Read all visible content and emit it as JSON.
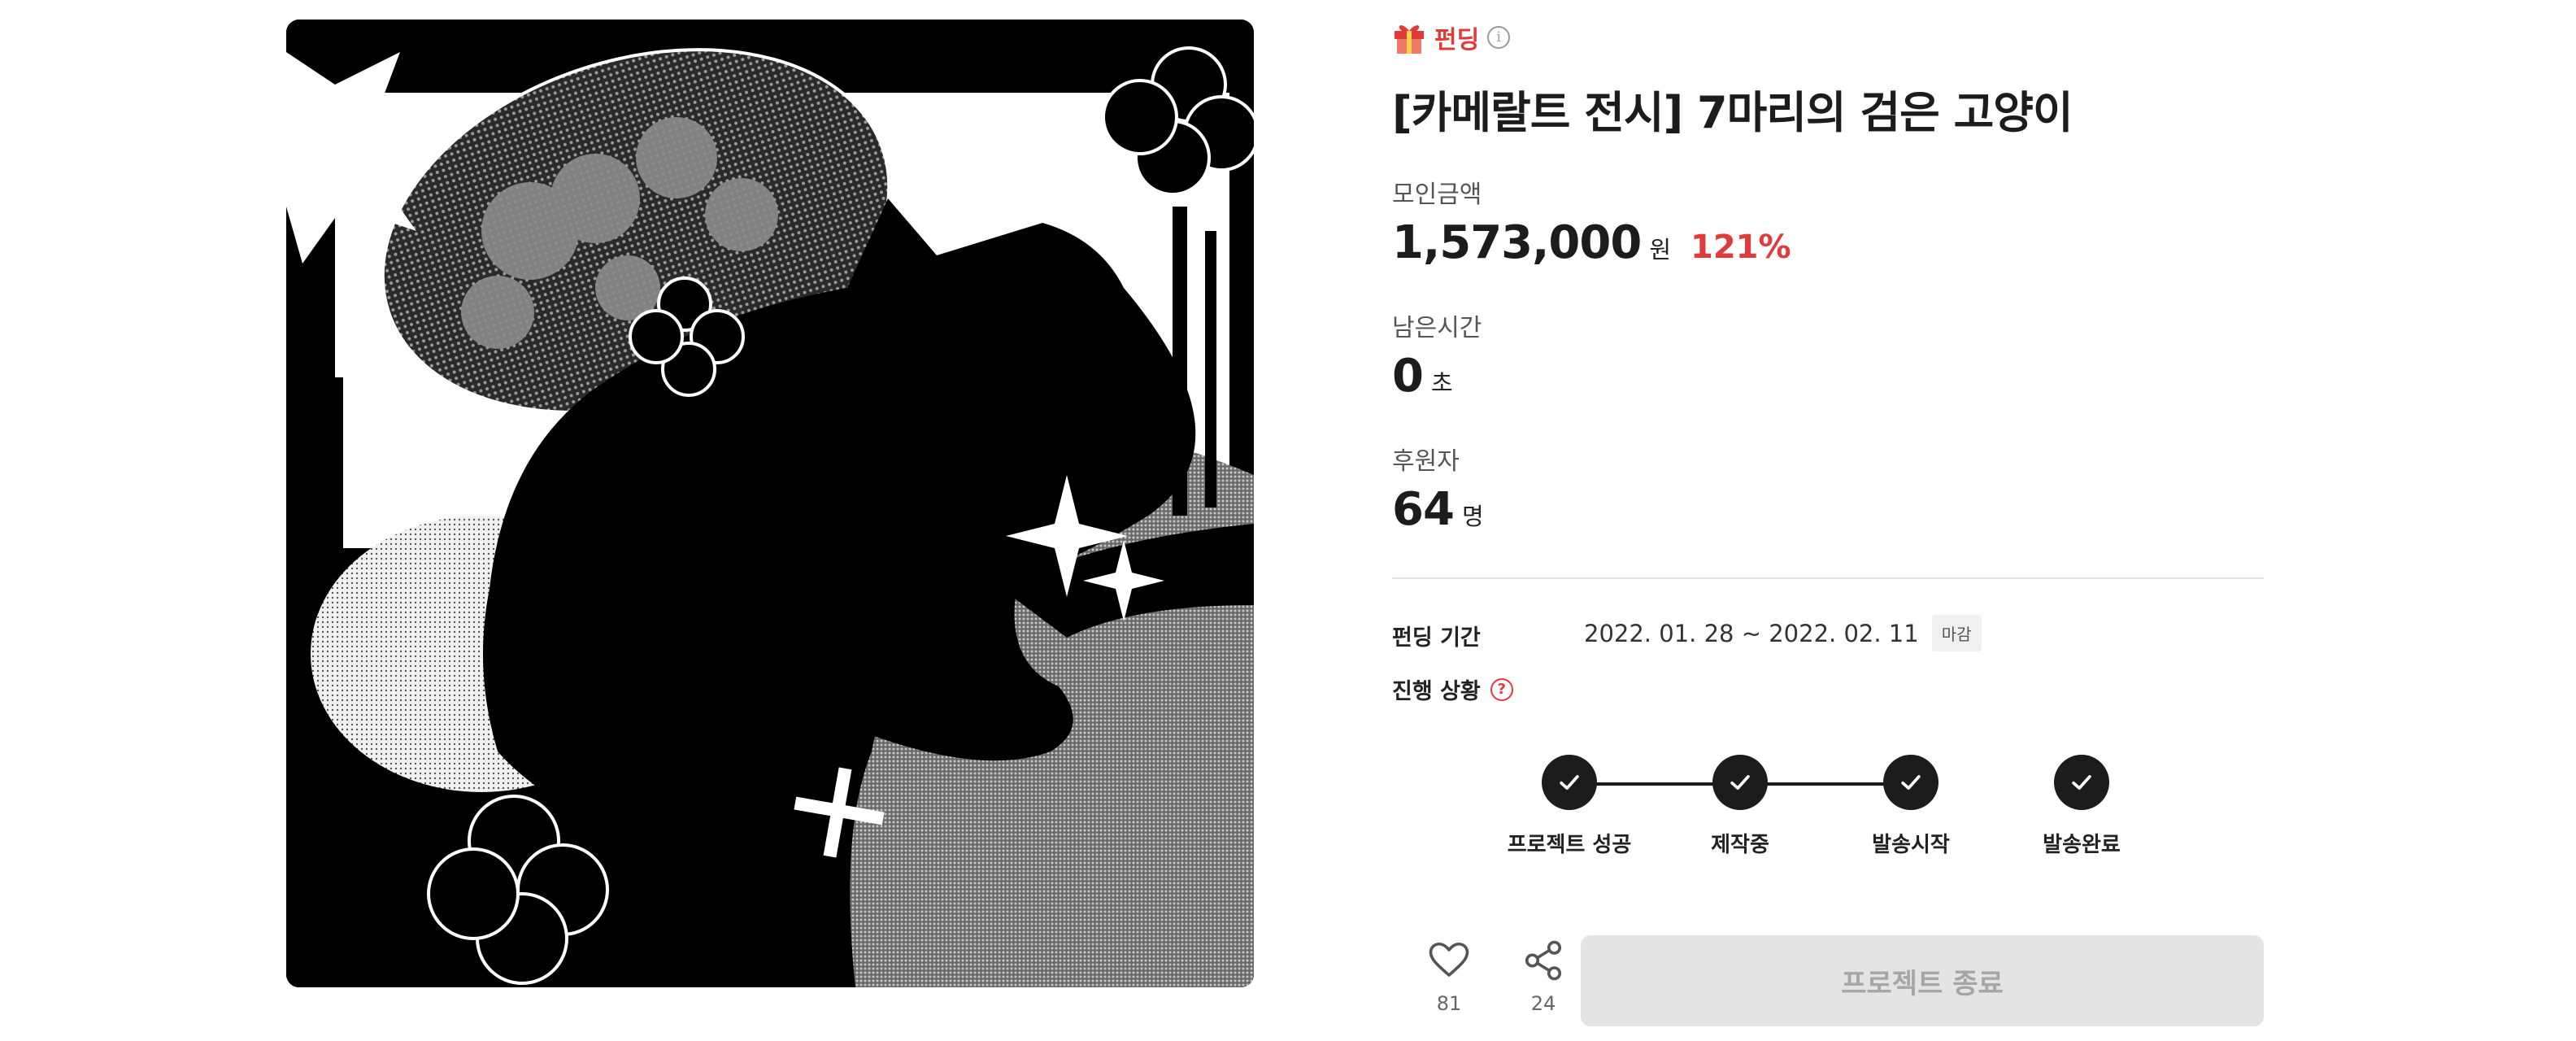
{
  "project": {
    "category": "펀딩",
    "category_icon": "gift-icon",
    "title": "[카메랄트 전시] 7마리의 검은 고양이"
  },
  "stats": {
    "amount_label": "모인금액",
    "amount_value": "1,573,000",
    "amount_unit": "원",
    "amount_percent": "121%",
    "time_label": "남은시간",
    "time_value": "0",
    "time_unit": "초",
    "backers_label": "후원자",
    "backers_value": "64",
    "backers_unit": "명"
  },
  "details": {
    "period_label": "펀딩 기간",
    "period_value": "2022. 01. 28 ~ 2022. 02. 11",
    "period_badge": "마감",
    "status_label": "진행 상황"
  },
  "steps": [
    {
      "label": "프로젝트 성공",
      "completed": true
    },
    {
      "label": "제작중",
      "completed": true
    },
    {
      "label": "발송시작",
      "completed": true
    },
    {
      "label": "발송완료",
      "completed": true
    }
  ],
  "actions": {
    "like_count": "81",
    "share_count": "24",
    "end_button_label": "프로젝트 종료"
  },
  "colors": {
    "accent": "#e03a3a",
    "dark": "#1c1c1c",
    "button_bg": "#e4e4e4",
    "button_text": "#a6a6a6"
  }
}
